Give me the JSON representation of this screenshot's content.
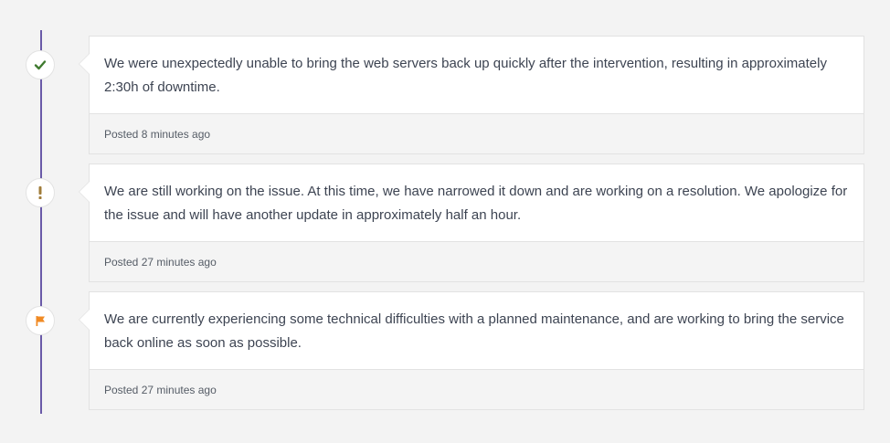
{
  "updates": [
    {
      "status_icon": "check-icon",
      "status_color": "#3f7a2f",
      "message": "We were unexpectedly unable to bring the web servers back up quickly after the intervention, resulting in approximately 2:30h of downtime.",
      "posted": "Posted 8 minutes ago"
    },
    {
      "status_icon": "exclamation-icon",
      "status_color": "#a07c3a",
      "message": "We are still working on the issue. At this time, we have narrowed it down and are working on a resolution. We apologize for the issue and will have another update in approximately half an hour.",
      "posted": "Posted 27 minutes ago"
    },
    {
      "status_icon": "flag-icon",
      "status_color": "#f08a24",
      "message": "We are currently experiencing some technical difficulties with a planned maintenance, and are working to bring the service back online as soon as possible.",
      "posted": "Posted 27 minutes ago"
    }
  ],
  "colors": {
    "timeline": "#6a5aa8",
    "background": "#f3f3f3"
  }
}
